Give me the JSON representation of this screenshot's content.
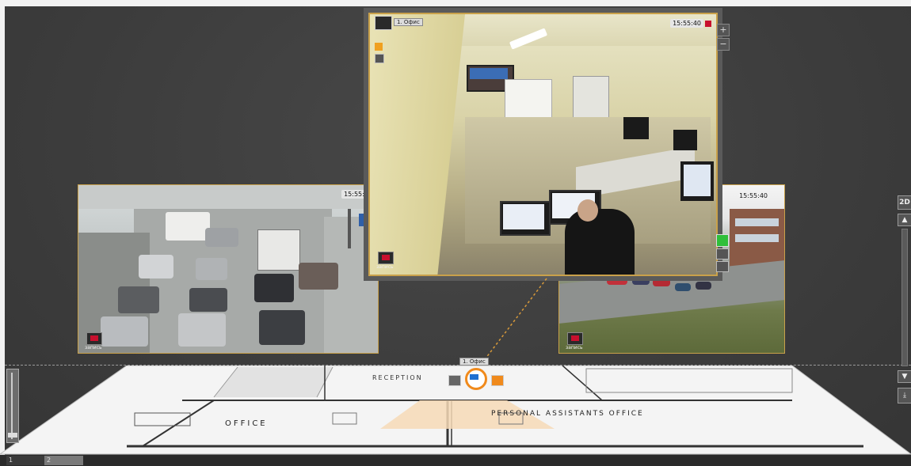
{
  "cameras": {
    "traffic": {
      "timestamp": "15:55:40",
      "rec_label": "запись"
    },
    "office": {
      "name": "1. Офис",
      "timestamp": "15:55:40",
      "rec_label": "запись"
    },
    "parking": {
      "timestamp": "15:55:40",
      "rec_label": "запись"
    }
  },
  "zoom": {
    "plus": "+",
    "minus": "−"
  },
  "right_panel": {
    "mode_button": "2D"
  },
  "floor_plan": {
    "camera_label": "1. Офис",
    "rooms": [
      "RECEPTION",
      "OFFICE",
      "PERSONAL ASSISTANTS OFFICE"
    ]
  },
  "layout_tabs": [
    "1",
    "2"
  ],
  "colors": {
    "accent": "#c9a14a",
    "camera_marker": "#f08a1c",
    "record": "#c8102e"
  },
  "icons": [
    "monitor-icon",
    "camera-marker-icon",
    "record-icon",
    "export-icon"
  ]
}
